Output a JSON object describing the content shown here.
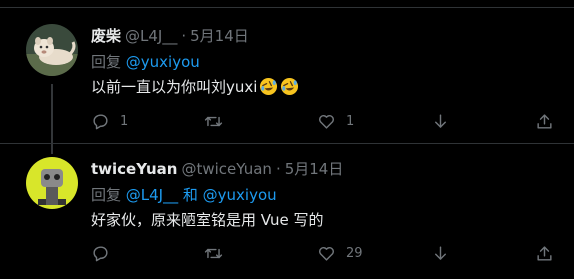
{
  "tweets": [
    {
      "name": "废柴",
      "handle": "@L4J__",
      "separator": "·",
      "date": "5月14日",
      "reply_prefix": "回复 ",
      "reply_to_1": "@yuxiyou",
      "reply_and": "",
      "reply_to_2": "",
      "text": "以前一直以为你叫刘yuxi",
      "emoji_icon": "rolling-on-floor-laughing-emoji",
      "replies": "1",
      "retweets": "",
      "likes": "1"
    },
    {
      "name": "twiceYuan",
      "handle": "@twiceYuan",
      "separator": "·",
      "date": "5月14日",
      "reply_prefix": "回复 ",
      "reply_to_1": "@L4J__",
      "reply_and": " 和 ",
      "reply_to_2": "@yuxiyou",
      "text": "好家伙，原来陋室铭是用 Vue 写的",
      "replies": "",
      "retweets": "",
      "likes": "29"
    }
  ],
  "colors": {
    "background": "#000000",
    "text": "#e7e9ea",
    "muted": "#71767b",
    "link": "#1d9bf0",
    "divider": "#2f3336"
  },
  "icons": [
    "reply-icon",
    "retweet-icon",
    "heart-icon",
    "bookmark-icon",
    "share-icon"
  ]
}
